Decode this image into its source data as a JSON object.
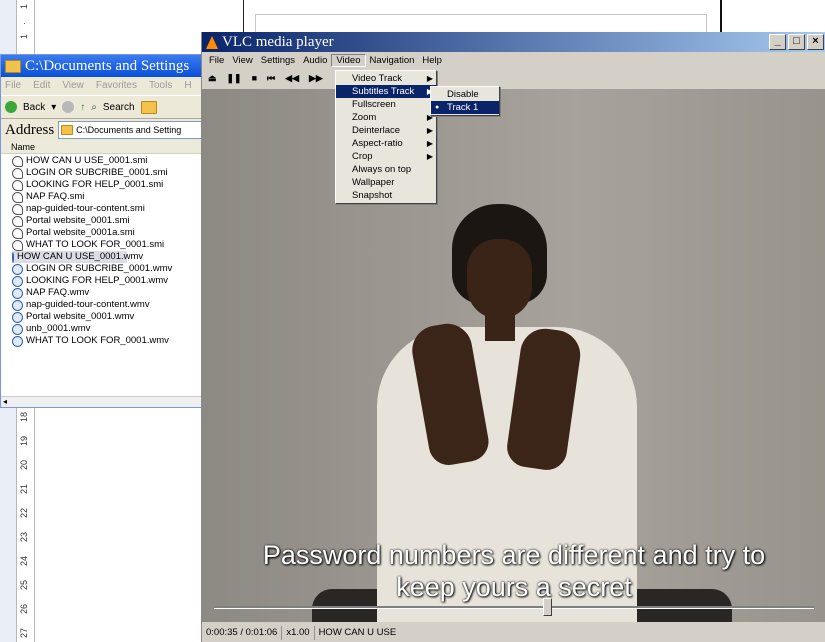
{
  "background_doc": {
    "ruler_top_marks": [
      "1",
      "·",
      "1"
    ],
    "ruler_bottom_marks": [
      "18",
      "19",
      "20",
      "21",
      "22",
      "23",
      "24",
      "25",
      "26",
      "27"
    ]
  },
  "explorer": {
    "title": "C:\\Documents and Settings",
    "menu": [
      "File",
      "Edit",
      "View",
      "Favorites",
      "Tools",
      "H"
    ],
    "toolbar": {
      "back_label": "Back",
      "search_label": "Search"
    },
    "address_label": "Address",
    "address_value": "C:\\Documents and Setting",
    "column_name": "Name",
    "files": [
      {
        "name": "HOW CAN U USE_0001.smi",
        "type": "smi"
      },
      {
        "name": "LOGIN OR SUBCRIBE_0001.smi",
        "type": "smi"
      },
      {
        "name": "LOOKING FOR HELP_0001.smi",
        "type": "smi"
      },
      {
        "name": "NAP FAQ.smi",
        "type": "smi"
      },
      {
        "name": "nap-guided-tour-content.smi",
        "type": "smi"
      },
      {
        "name": "Portal website_0001.smi",
        "type": "smi"
      },
      {
        "name": "Portal website_0001a.smi",
        "type": "smi"
      },
      {
        "name": "WHAT TO LOOK FOR_0001.smi",
        "type": "smi"
      },
      {
        "name": "HOW CAN U USE_0001.wmv",
        "type": "wmv",
        "selected": true
      },
      {
        "name": "LOGIN OR SUBCRIBE_0001.wmv",
        "type": "wmv"
      },
      {
        "name": "LOOKING FOR HELP_0001.wmv",
        "type": "wmv"
      },
      {
        "name": "NAP FAQ.wmv",
        "type": "wmv"
      },
      {
        "name": "nap-guided-tour-content.wmv",
        "type": "wmv"
      },
      {
        "name": "Portal website_0001.wmv",
        "type": "wmv"
      },
      {
        "name": "unb_0001.wmv",
        "type": "wmv"
      },
      {
        "name": "WHAT TO LOOK FOR_0001.wmv",
        "type": "wmv"
      }
    ]
  },
  "vlc": {
    "title": "VLC media player",
    "window_buttons": {
      "minimize": "_",
      "maximize": "□",
      "close": "×"
    },
    "menu": [
      "File",
      "View",
      "Settings",
      "Audio",
      "Video",
      "Navigation",
      "Help"
    ],
    "active_menu": "Video",
    "toolbar": {
      "eject": "⏏",
      "pause": "❚❚",
      "stop": "■",
      "prev": "⏮",
      "rewind": "◀◀",
      "forward": "▶▶"
    },
    "video_menu": [
      {
        "label": "Video Track",
        "submenu": true
      },
      {
        "label": "Subtitles Track",
        "submenu": true,
        "highlighted": true
      },
      {
        "label": "Fullscreen"
      },
      {
        "label": "Zoom",
        "submenu": true
      },
      {
        "label": "Deinterlace",
        "submenu": true
      },
      {
        "label": "Aspect-ratio",
        "submenu": true
      },
      {
        "label": "Crop",
        "submenu": true
      },
      {
        "label": "Always on top"
      },
      {
        "label": "Wallpaper"
      },
      {
        "label": "Snapshot"
      }
    ],
    "subtitles_submenu": [
      {
        "label": "Disable"
      },
      {
        "label": "Track 1",
        "checked": true,
        "highlighted": true
      }
    ],
    "subtitle_lines": [
      "Password numbers are different and try to",
      "keep yours a secret"
    ],
    "seek_position": 0.555,
    "status": {
      "time": "0:00:35 / 0:01:06",
      "speed": "x1.00",
      "title": "HOW CAN U USE"
    }
  }
}
